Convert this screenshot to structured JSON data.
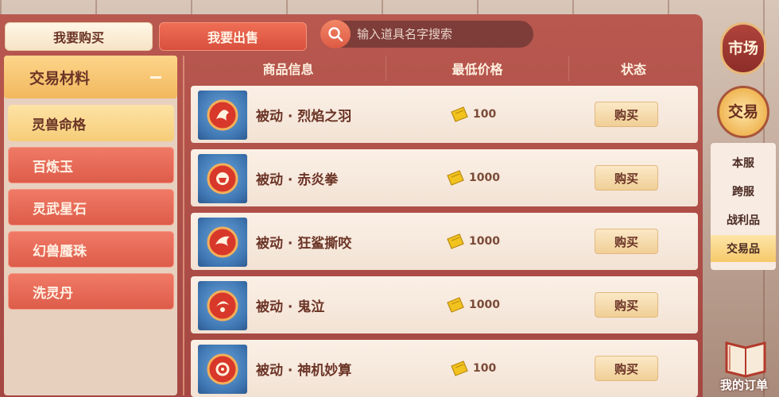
{
  "tabs": {
    "buy_label": "我要购买",
    "sell_label": "我要出售"
  },
  "search": {
    "placeholder": "输入道具名字搜索",
    "icon": "search-icon"
  },
  "category": {
    "header_label": "交易材料",
    "items": [
      {
        "label": "灵兽命格",
        "selected": true
      },
      {
        "label": "百炼玉",
        "selected": false
      },
      {
        "label": "灵武星石",
        "selected": false
      },
      {
        "label": "幻兽蜃珠",
        "selected": false
      },
      {
        "label": "洗灵丹",
        "selected": false
      }
    ]
  },
  "table": {
    "headers": [
      "商品信息",
      "最低价格",
      "状态"
    ],
    "rows": [
      {
        "name": "被动 · 烈焰之羽",
        "price": "100",
        "action": "购买"
      },
      {
        "name": "被动 · 赤炎拳",
        "price": "1000",
        "action": "购买"
      },
      {
        "name": "被动 · 狂鲨撕咬",
        "price": "1000",
        "action": "购买"
      },
      {
        "name": "被动 · 鬼泣",
        "price": "1000",
        "action": "购买"
      },
      {
        "name": "被动 · 神机妙算",
        "price": "100",
        "action": "购买"
      }
    ]
  },
  "side": {
    "market_label": "市场",
    "trade_label": "交易",
    "nav": [
      {
        "label": "本服",
        "active": false
      },
      {
        "label": "跨服",
        "active": false
      },
      {
        "label": "战利品",
        "active": false
      },
      {
        "label": "交易品",
        "active": true
      }
    ],
    "orders_label": "我的订单"
  },
  "colors": {
    "panel": "#b8584f",
    "accent": "#f6c96a",
    "text_dark": "#6b3426"
  }
}
